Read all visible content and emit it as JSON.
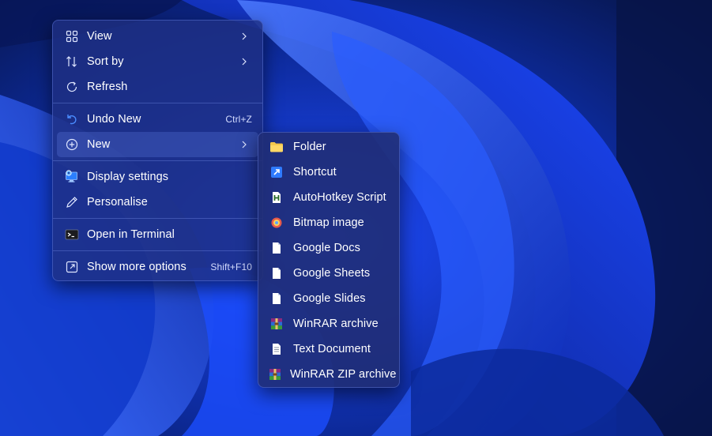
{
  "context_menu": {
    "items": [
      {
        "id": "view",
        "label": "View",
        "icon": "grid-icon",
        "has_submenu": true
      },
      {
        "id": "sort-by",
        "label": "Sort by",
        "icon": "sort-icon",
        "has_submenu": true
      },
      {
        "id": "refresh",
        "label": "Refresh",
        "icon": "refresh-icon"
      },
      {
        "id": "undo-new",
        "label": "Undo New",
        "icon": "undo-icon",
        "shortcut": "Ctrl+Z"
      },
      {
        "id": "new",
        "label": "New",
        "icon": "add-circle-icon",
        "has_submenu": true,
        "active": true
      },
      {
        "id": "display-settings",
        "label": "Display settings",
        "icon": "display-settings-icon"
      },
      {
        "id": "personalise",
        "label": "Personalise",
        "icon": "pen-icon"
      },
      {
        "id": "open-in-terminal",
        "label": "Open in Terminal",
        "icon": "terminal-icon"
      },
      {
        "id": "show-more-options",
        "label": "Show more options",
        "icon": "open-external-icon",
        "shortcut": "Shift+F10"
      }
    ]
  },
  "new_submenu": {
    "items": [
      {
        "id": "folder",
        "label": "Folder",
        "icon": "folder-icon"
      },
      {
        "id": "shortcut",
        "label": "Shortcut",
        "icon": "shortcut-icon"
      },
      {
        "id": "autohotkey-script",
        "label": "AutoHotkey Script",
        "icon": "autohotkey-icon"
      },
      {
        "id": "bitmap-image",
        "label": "Bitmap image",
        "icon": "bitmap-icon"
      },
      {
        "id": "google-docs",
        "label": "Google Docs",
        "icon": "document-icon"
      },
      {
        "id": "google-sheets",
        "label": "Google Sheets",
        "icon": "document-icon"
      },
      {
        "id": "google-slides",
        "label": "Google Slides",
        "icon": "document-icon"
      },
      {
        "id": "winrar-archive",
        "label": "WinRAR archive",
        "icon": "winrar-icon"
      },
      {
        "id": "text-document",
        "label": "Text Document",
        "icon": "text-document-icon"
      },
      {
        "id": "winrar-zip-archive",
        "label": "WinRAR ZIP archive",
        "icon": "winrar-icon"
      }
    ]
  },
  "colors": {
    "menu_bg": "#1e3082",
    "accent": "#2f6bff",
    "folder": "#f5c84c"
  }
}
